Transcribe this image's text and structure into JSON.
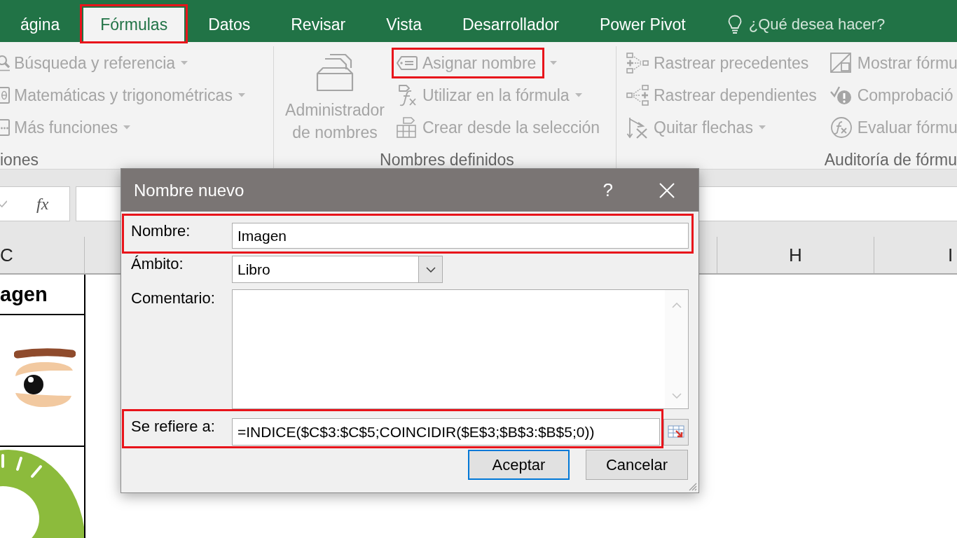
{
  "ribbon_tabs": [
    {
      "label": "ágina",
      "selected": false,
      "highlighted": false
    },
    {
      "label": "Fórmulas",
      "selected": true,
      "highlighted": true
    },
    {
      "label": "Datos",
      "selected": false,
      "highlighted": false
    },
    {
      "label": "Revisar",
      "selected": false,
      "highlighted": false
    },
    {
      "label": "Vista",
      "selected": false,
      "highlighted": false
    },
    {
      "label": "Desarrollador",
      "selected": false,
      "highlighted": false
    },
    {
      "label": "Power Pivot",
      "selected": false,
      "highlighted": false
    }
  ],
  "tell_me": {
    "placeholder": "¿Qué desea hacer?"
  },
  "ribbon": {
    "groups": [
      {
        "label": "iones",
        "columns": [
          [
            {
              "kind": "small",
              "label": "Búsqueda y referencia",
              "dropdown": true,
              "disabled": true,
              "highlighted": false
            },
            {
              "kind": "small",
              "label": "Matemáticas y trigonométricas",
              "dropdown": true,
              "disabled": true,
              "highlighted": false
            },
            {
              "kind": "small",
              "label": "Más funciones",
              "dropdown": true,
              "disabled": true,
              "highlighted": false
            }
          ]
        ]
      },
      {
        "label": "Nombres definidos",
        "columns": [
          [
            {
              "kind": "large",
              "label": "Administrador de nombres",
              "dropdown": false,
              "disabled": true,
              "highlighted": false
            }
          ],
          [
            {
              "kind": "small",
              "label": "Asignar nombre",
              "dropdown": true,
              "disabled": true,
              "highlighted": true
            },
            {
              "kind": "small",
              "label": "Utilizar en la fórmula",
              "dropdown": true,
              "disabled": true,
              "highlighted": false
            },
            {
              "kind": "small",
              "label": "Crear desde la selección",
              "dropdown": false,
              "disabled": true,
              "highlighted": false
            }
          ]
        ]
      },
      {
        "label": "Auditoría de fórmu",
        "columns": [
          [
            {
              "kind": "small",
              "label": "Rastrear precedentes",
              "dropdown": false,
              "disabled": true,
              "highlighted": false
            },
            {
              "kind": "small",
              "label": "Rastrear dependientes",
              "dropdown": false,
              "disabled": true,
              "highlighted": false
            },
            {
              "kind": "small",
              "label": "Quitar flechas",
              "dropdown": true,
              "disabled": true,
              "highlighted": false
            }
          ],
          [
            {
              "kind": "small",
              "label": "Mostrar fórmu",
              "dropdown": false,
              "disabled": true,
              "highlighted": false
            },
            {
              "kind": "small",
              "label": "Comprobació",
              "dropdown": false,
              "disabled": true,
              "highlighted": false
            },
            {
              "kind": "small",
              "label": "Evaluar fórmu",
              "dropdown": false,
              "disabled": true,
              "highlighted": false
            }
          ]
        ]
      }
    ]
  },
  "formula_bar": {
    "function_button": "fx"
  },
  "sheet": {
    "columns": [
      {
        "label": "C"
      },
      {
        "label": "H"
      },
      {
        "label": "I"
      }
    ],
    "column_c_cells": [
      {
        "kind": "text",
        "text": "agen"
      },
      {
        "kind": "picture"
      },
      {
        "kind": "picture"
      }
    ]
  },
  "dialog": {
    "title": "Nombre nuevo",
    "help_button": "?",
    "fields": [
      {
        "kind": "text",
        "label": "Nombre:",
        "value": "Imagen",
        "highlighted": true
      },
      {
        "kind": "dropdown",
        "label": "Ámbito:",
        "value": "Libro",
        "highlighted": false
      },
      {
        "kind": "textarea",
        "label": "Comentario:",
        "highlighted": false
      },
      {
        "kind": "reference",
        "label": "Se refiere a:",
        "value": "=INDICE($C$3:$C$5;COINCIDIR($E$3;$B$3:$B$5;0))",
        "highlighted": true
      }
    ],
    "buttons": [
      {
        "label": "Aceptar",
        "focused": true
      },
      {
        "label": "Cancelar",
        "focused": false
      }
    ]
  }
}
